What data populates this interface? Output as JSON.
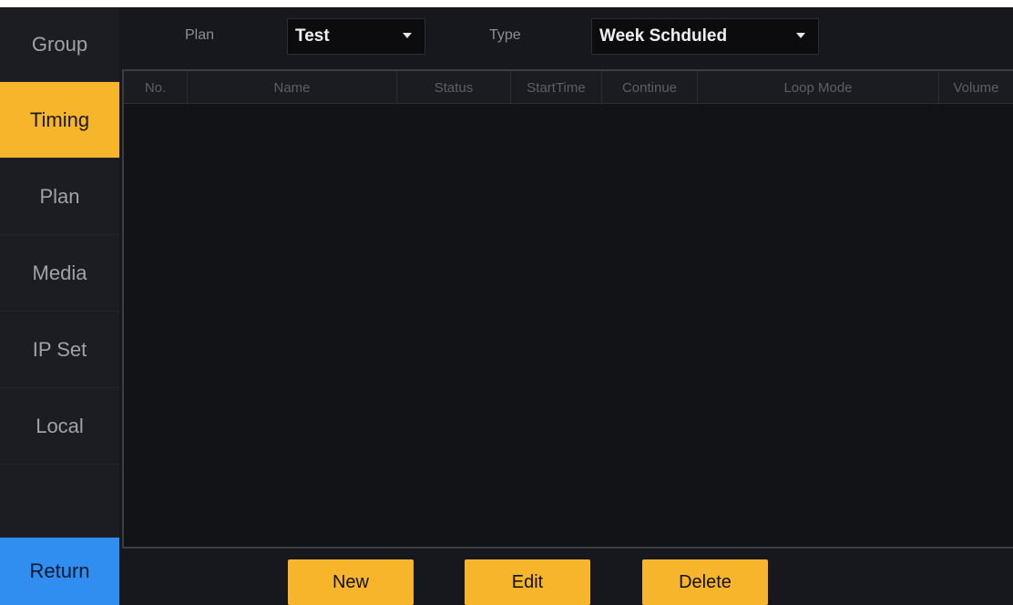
{
  "sidebar": {
    "items": [
      {
        "label": "Group"
      },
      {
        "label": "Timing"
      },
      {
        "label": "Plan"
      },
      {
        "label": "Media"
      },
      {
        "label": "IP Set"
      },
      {
        "label": "Local"
      }
    ],
    "return_label": "Return"
  },
  "toolbar": {
    "plan_label": "Plan",
    "plan_value": "Test",
    "type_label": "Type",
    "type_value": "Week Schduled"
  },
  "table": {
    "columns": [
      "No.",
      "Name",
      "Status",
      "StartTime",
      "Continue",
      "Loop Mode",
      "Volume"
    ],
    "rows": []
  },
  "footer": {
    "new_label": "New",
    "edit_label": "Edit",
    "delete_label": "Delete"
  },
  "colors": {
    "accent": "#f7b52b",
    "return": "#2f8ef0",
    "background": "#16181d"
  }
}
